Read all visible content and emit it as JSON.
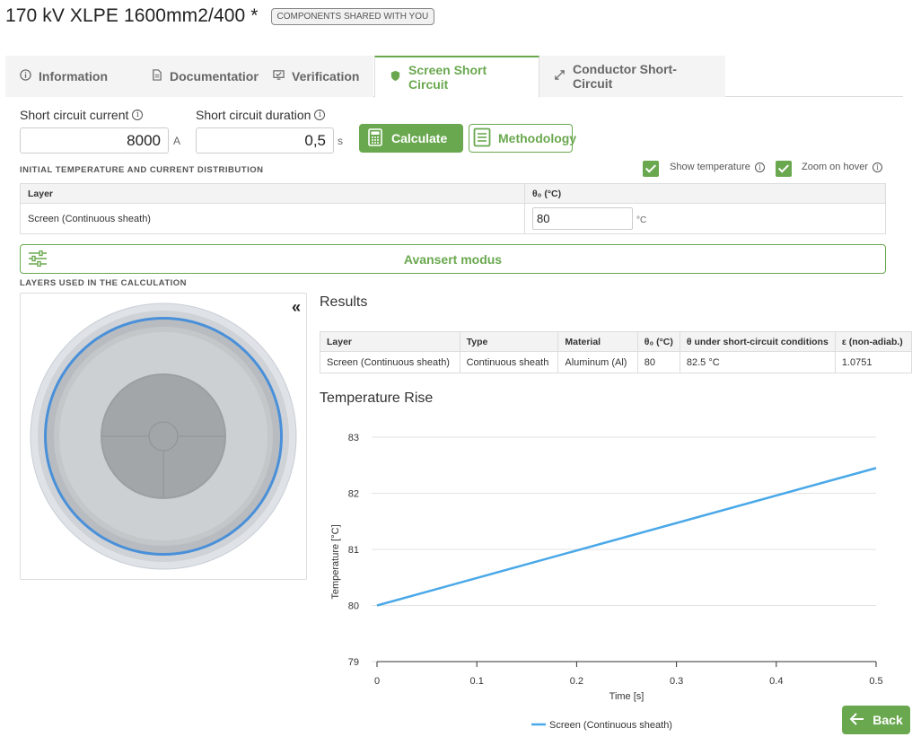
{
  "header": {
    "title": "170 kV XLPE 1600mm2/400 *",
    "badge": "COMPONENTS SHARED WITH YOU"
  },
  "tabs": [
    {
      "label": "Information",
      "icon": "info-icon",
      "active": false
    },
    {
      "label": "Documentation",
      "icon": "document-icon",
      "active": false
    },
    {
      "label": "Verification",
      "icon": "verification-icon",
      "active": false
    },
    {
      "label": "Screen Short Circuit",
      "icon": "shield-icon",
      "active": true
    },
    {
      "label": "Conductor Short-Circuit",
      "icon": "expand-arrows-icon",
      "active": false
    }
  ],
  "inputs": {
    "current": {
      "label": "Short circuit current",
      "value": "8000",
      "unit": "A"
    },
    "duration": {
      "label": "Short circuit duration",
      "value": "0,5",
      "unit": "s"
    }
  },
  "buttons": {
    "calculate": "Calculate",
    "methodology": "Methodology",
    "advanced": "Avansert modus",
    "back": "Back"
  },
  "initial": {
    "caption": "INITIAL TEMPERATURE AND CURRENT DISTRIBUTION",
    "show_temperature": "Show temperature",
    "zoom_on_hover": "Zoom on hover",
    "columns": [
      "Layer",
      "θ₀ (°C)"
    ],
    "rows": [
      {
        "layer": "Screen (Continuous sheath)",
        "temp": "80",
        "unit": "°C"
      }
    ]
  },
  "layers_caption": "LAYERS USED IN THE CALCULATION",
  "results": {
    "title": "Results",
    "columns": [
      "Layer",
      "Type",
      "Material",
      "θ₀ (°C)",
      "θ under short-circuit conditions",
      "ε (non-adiab.)"
    ],
    "rows": [
      [
        "Screen (Continuous sheath)",
        "Continuous sheath",
        "Aluminum (Al)",
        "80",
        "82.5 °C",
        "1.0751"
      ]
    ]
  },
  "chart_data": {
    "type": "line",
    "title": "Temperature Rise",
    "xlabel": "Time [s]",
    "ylabel": "Temperature [°C]",
    "xlim": [
      0,
      0.5
    ],
    "ylim": [
      79,
      83
    ],
    "x_ticks": [
      "0",
      "0.1",
      "0.2",
      "0.3",
      "0.4",
      "0.5"
    ],
    "y_ticks": [
      "79",
      "80",
      "81",
      "82",
      "83"
    ],
    "grid": true,
    "legend_position": "bottom",
    "series": [
      {
        "name": "Screen (Continuous sheath)",
        "color": "#4aa8e8",
        "x": [
          0,
          0.5
        ],
        "y": [
          80,
          82.45
        ]
      }
    ]
  },
  "colors": {
    "accent": "#6aa84f",
    "series": "#4aa8e8"
  }
}
